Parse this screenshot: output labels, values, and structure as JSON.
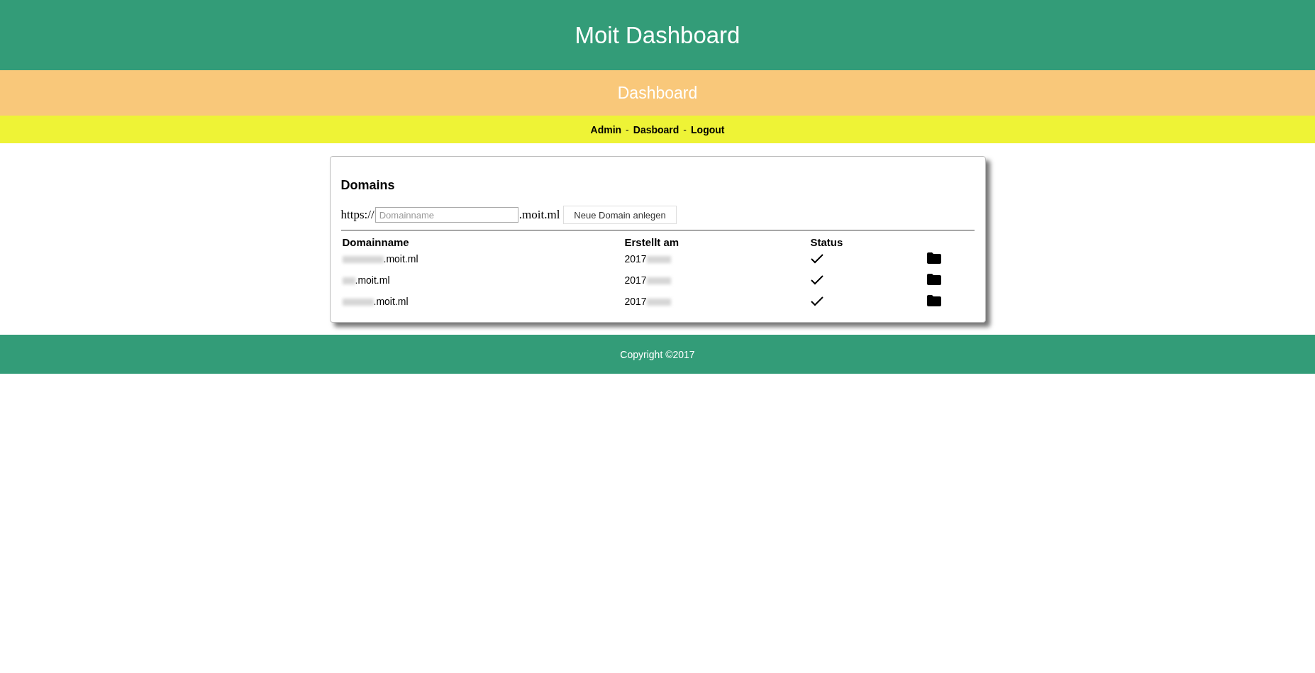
{
  "header": {
    "title": "Moit Dashboard"
  },
  "subheader": {
    "title": "Dashboard"
  },
  "nav": [
    {
      "kind": "link",
      "text": "Admin"
    },
    {
      "kind": "separator",
      "text": "-"
    },
    {
      "kind": "link",
      "text": "Dasboard"
    },
    {
      "kind": "separator",
      "text": "-"
    },
    {
      "kind": "link",
      "text": "Logout"
    }
  ],
  "card": {
    "title": "Domains",
    "form": {
      "prefix": "https://",
      "placeholder": "Domainname",
      "suffix": ".moit.ml",
      "button": "Neue Domain anlegen"
    },
    "table": {
      "columns": [
        "Domainname",
        "Erstellt am",
        "Status"
      ],
      "rows": [
        {
          "domain": ".moit.ml",
          "created": "2017",
          "active": true
        },
        {
          "domain": ".moit.ml",
          "created": "2017",
          "active": true
        },
        {
          "domain": ".moit.ml",
          "created": "2017",
          "active": true
        }
      ]
    }
  },
  "footer": {
    "text": "Copyright ©2017"
  }
}
